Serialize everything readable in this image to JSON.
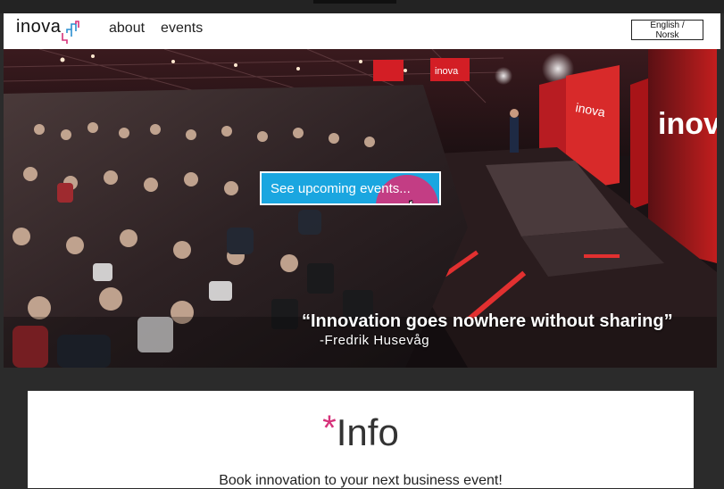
{
  "nav": {
    "logo_text": "inova",
    "links": [
      "about",
      "events"
    ],
    "language_label": "English / Norsk"
  },
  "hero": {
    "cta_label": "See upcoming events...",
    "quote": "“Innovation goes nowhere without sharing”",
    "quote_author": "-Fredrik Husevåg",
    "screen_brand": "inova"
  },
  "info": {
    "asterisk": "*",
    "title": "Info",
    "subtitle": "Book innovation to your next business event!"
  },
  "colors": {
    "accent_blue": "#1aa6e0",
    "accent_pink": "#d6327a",
    "logo_blue": "#2c8fd1",
    "logo_pink": "#d6327a"
  }
}
